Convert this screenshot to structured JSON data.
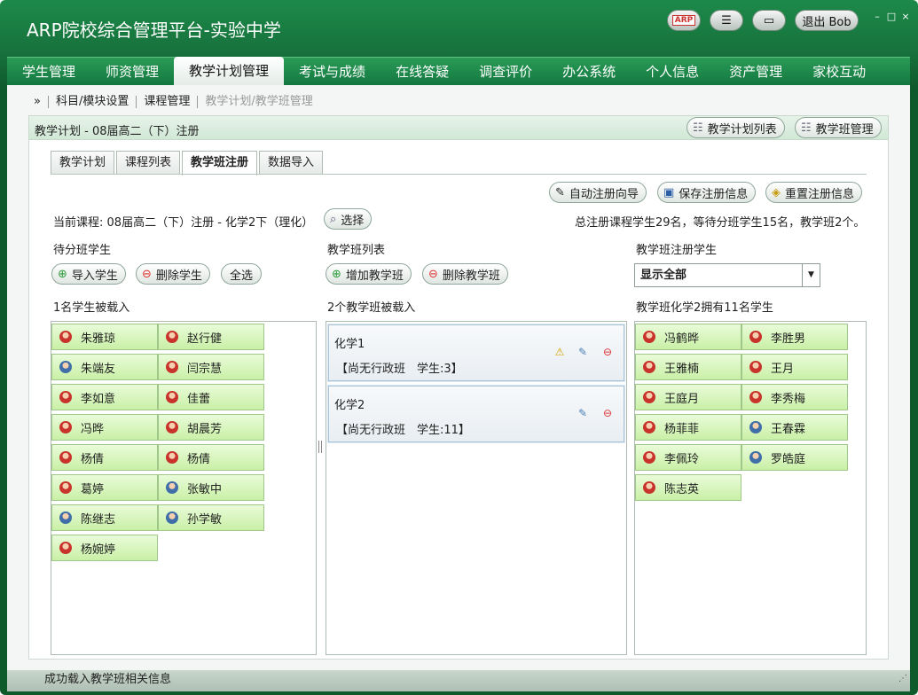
{
  "app": {
    "title": "ARP院校综合管理平台-实验中学",
    "logout_label": "退出 Bob"
  },
  "nav": [
    {
      "label": "学生管理"
    },
    {
      "label": "师资管理"
    },
    {
      "label": "教学计划管理",
      "active": true
    },
    {
      "label": "考试与成绩"
    },
    {
      "label": "在线答疑"
    },
    {
      "label": "调查评价"
    },
    {
      "label": "办公系统"
    },
    {
      "label": "个人信息"
    },
    {
      "label": "资产管理"
    },
    {
      "label": "家校互动"
    }
  ],
  "breadcrumb": [
    "»",
    "科目/模块设置",
    "课程管理",
    "教学计划/教学班管理"
  ],
  "panel": {
    "title": "教学计划 - 08届高二（下）注册",
    "btn_plan_list": "教学计划列表",
    "btn_class_manage": "教学班管理"
  },
  "tabs": [
    {
      "label": "教学计划"
    },
    {
      "label": "课程列表"
    },
    {
      "label": "教学班注册",
      "active": true
    },
    {
      "label": "数据导入"
    }
  ],
  "actions": {
    "auto_wizard": "自动注册向导",
    "save": "保存注册信息",
    "reset": "重置注册信息"
  },
  "course": {
    "current_label": "当前课程:",
    "current_value": "08届高二（下）注册 - 化学2下（理化）",
    "select_button": "选择",
    "summary": "总注册课程学生29名，等待分班学生15名，教学班2个。"
  },
  "left": {
    "title": "待分班学生",
    "btn_import": "导入学生",
    "btn_delete": "删除学生",
    "btn_select_all": "全选",
    "loaded_text": "1名学生被载入",
    "students": [
      {
        "name": "朱雅琼",
        "gender": "f"
      },
      {
        "name": "赵行健",
        "gender": "f"
      },
      {
        "name": "朱端友",
        "gender": "m"
      },
      {
        "name": "闫宗慧",
        "gender": "f"
      },
      {
        "name": "李如意",
        "gender": "f"
      },
      {
        "name": "佳蕾",
        "gender": "f"
      },
      {
        "name": "冯晔",
        "gender": "f"
      },
      {
        "name": "胡晨芳",
        "gender": "f"
      },
      {
        "name": "杨倩",
        "gender": "f"
      },
      {
        "name": "杨倩",
        "gender": "f"
      },
      {
        "name": "葛婷",
        "gender": "f"
      },
      {
        "name": "张敏中",
        "gender": "m"
      },
      {
        "name": "陈继志",
        "gender": "m"
      },
      {
        "name": "孙学敏",
        "gender": "m"
      },
      {
        "name": "杨婉婷",
        "gender": "f"
      }
    ]
  },
  "middle": {
    "title": "教学班列表",
    "btn_add": "增加教学班",
    "btn_delete": "删除教学班",
    "loaded_text": "2个教学班被载入",
    "classes": [
      {
        "name": "化学1",
        "info": "【尚无行政班　学生:3】"
      },
      {
        "name": "化学2",
        "info": "【尚无行政班　学生:11】"
      }
    ]
  },
  "right": {
    "title": "教学班注册学生",
    "filter_value": "显示全部",
    "loaded_text": "教学班化学2拥有11名学生",
    "students": [
      {
        "name": "冯鹤晔",
        "gender": "f"
      },
      {
        "name": "李胜男",
        "gender": "f"
      },
      {
        "name": "王雅楠",
        "gender": "f"
      },
      {
        "name": "王月",
        "gender": "f"
      },
      {
        "name": "王庭月",
        "gender": "f"
      },
      {
        "name": "李秀梅",
        "gender": "f"
      },
      {
        "name": "杨菲菲",
        "gender": "f"
      },
      {
        "name": "王春霖",
        "gender": "m"
      },
      {
        "name": "李佩玲",
        "gender": "f"
      },
      {
        "name": "罗皓庭",
        "gender": "m"
      },
      {
        "name": "陈志英",
        "gender": "f"
      }
    ]
  },
  "status": "成功载入教学班相关信息"
}
